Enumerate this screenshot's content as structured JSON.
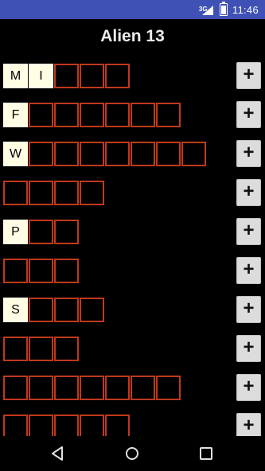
{
  "status_bar": {
    "network": "3G",
    "time": "11:46",
    "icons": [
      "signal-icon",
      "battery-icon"
    ]
  },
  "header": {
    "title": "Alien 13"
  },
  "rows": [
    {
      "cells": [
        "M",
        "I",
        "",
        "",
        ""
      ]
    },
    {
      "cells": [
        "F",
        "",
        "",
        "",
        "",
        "",
        ""
      ]
    },
    {
      "cells": [
        "W",
        "",
        "",
        "",
        "",
        "",
        "",
        ""
      ]
    },
    {
      "cells": [
        "",
        "",
        "",
        ""
      ]
    },
    {
      "cells": [
        "P",
        "",
        ""
      ]
    },
    {
      "cells": [
        "",
        "",
        ""
      ]
    },
    {
      "cells": [
        "S",
        "",
        "",
        ""
      ]
    },
    {
      "cells": [
        "",
        "",
        ""
      ]
    },
    {
      "cells": [
        "",
        "",
        "",
        "",
        "",
        "",
        ""
      ]
    },
    {
      "cells": [
        "",
        "",
        "",
        "",
        ""
      ]
    }
  ],
  "plus_label": "+",
  "nav": {
    "icons": [
      "back-icon",
      "home-icon",
      "recents-icon"
    ]
  },
  "colors": {
    "status_bar": "#3f51b5",
    "cell_border": "#c0391b",
    "cell_filled": "#fffde3",
    "button_bg": "#dcdcdc"
  }
}
